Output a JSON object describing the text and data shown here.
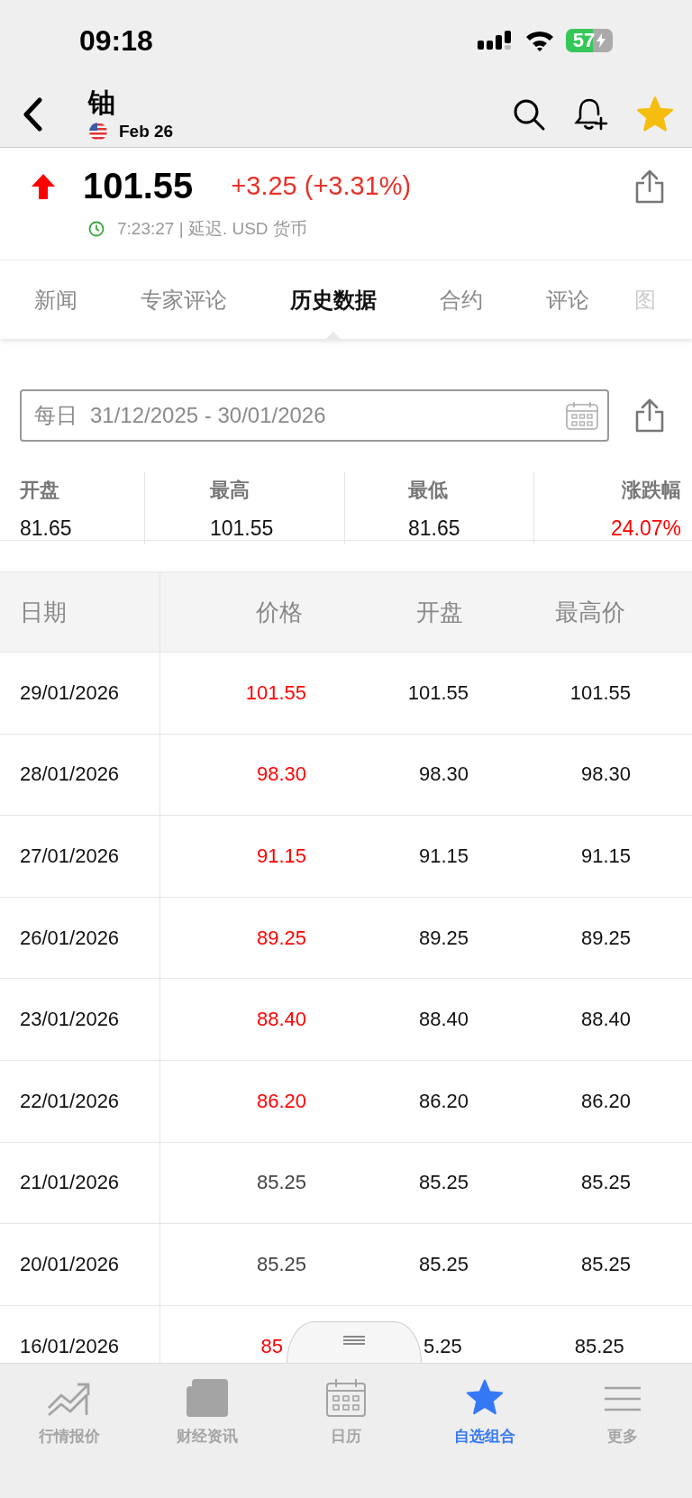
{
  "status_bar": {
    "time": "09:18",
    "battery": "57"
  },
  "header": {
    "title": "铀",
    "date": "Feb 26",
    "favorited": true
  },
  "quote": {
    "up": true,
    "price": "101.55",
    "change": "+3.25 (+3.31%)",
    "time_info": "7:23:27 | 延迟. USD 货币"
  },
  "tabs": [
    {
      "label": "新闻",
      "selected": false
    },
    {
      "label": "专家评论",
      "selected": false
    },
    {
      "label": "历史数据",
      "selected": true
    },
    {
      "label": "合约",
      "selected": false
    },
    {
      "label": "评论",
      "selected": false
    },
    {
      "label": "图",
      "selected": false
    }
  ],
  "date_range": {
    "period": "每日",
    "value": "31/12/2025 - 30/01/2026"
  },
  "stats": [
    {
      "label": "开盘",
      "value": "81.65",
      "positive": false
    },
    {
      "label": "最高",
      "value": "101.55",
      "positive": false
    },
    {
      "label": "最低",
      "value": "81.65",
      "positive": false
    },
    {
      "label": "涨跌幅",
      "value": "24.07%",
      "positive": true
    }
  ],
  "table": {
    "columns": [
      "日期",
      "价格",
      "开盘",
      "最高价"
    ],
    "rows": [
      {
        "date": "29/01/2026",
        "price": "101.55",
        "up": true,
        "open": "101.55",
        "high": "101.55"
      },
      {
        "date": "28/01/2026",
        "price": "98.30",
        "up": true,
        "open": "98.30",
        "high": "98.30"
      },
      {
        "date": "27/01/2026",
        "price": "91.15",
        "up": true,
        "open": "91.15",
        "high": "91.15"
      },
      {
        "date": "26/01/2026",
        "price": "89.25",
        "up": true,
        "open": "89.25",
        "high": "89.25"
      },
      {
        "date": "23/01/2026",
        "price": "88.40",
        "up": true,
        "open": "88.40",
        "high": "88.40"
      },
      {
        "date": "22/01/2026",
        "price": "86.20",
        "up": true,
        "open": "86.20",
        "high": "86.20"
      },
      {
        "date": "21/01/2026",
        "price": "85.25",
        "up": false,
        "open": "85.25",
        "high": "85.25"
      },
      {
        "date": "20/01/2026",
        "price": "85.25",
        "up": false,
        "open": "85.25",
        "high": "85.25"
      },
      {
        "date": "16/01/2026",
        "price": "85",
        "up": true,
        "open": "5.25",
        "high": "85.25"
      }
    ]
  },
  "bottom_nav": [
    {
      "label": "行情报价",
      "kind": "chart",
      "selected": false
    },
    {
      "label": "财经资讯",
      "kind": "news",
      "selected": false
    },
    {
      "label": "日历",
      "kind": "calendar",
      "selected": false
    },
    {
      "label": "自选组合",
      "kind": "star",
      "selected": true
    },
    {
      "label": "更多",
      "kind": "menu",
      "selected": false
    }
  ]
}
